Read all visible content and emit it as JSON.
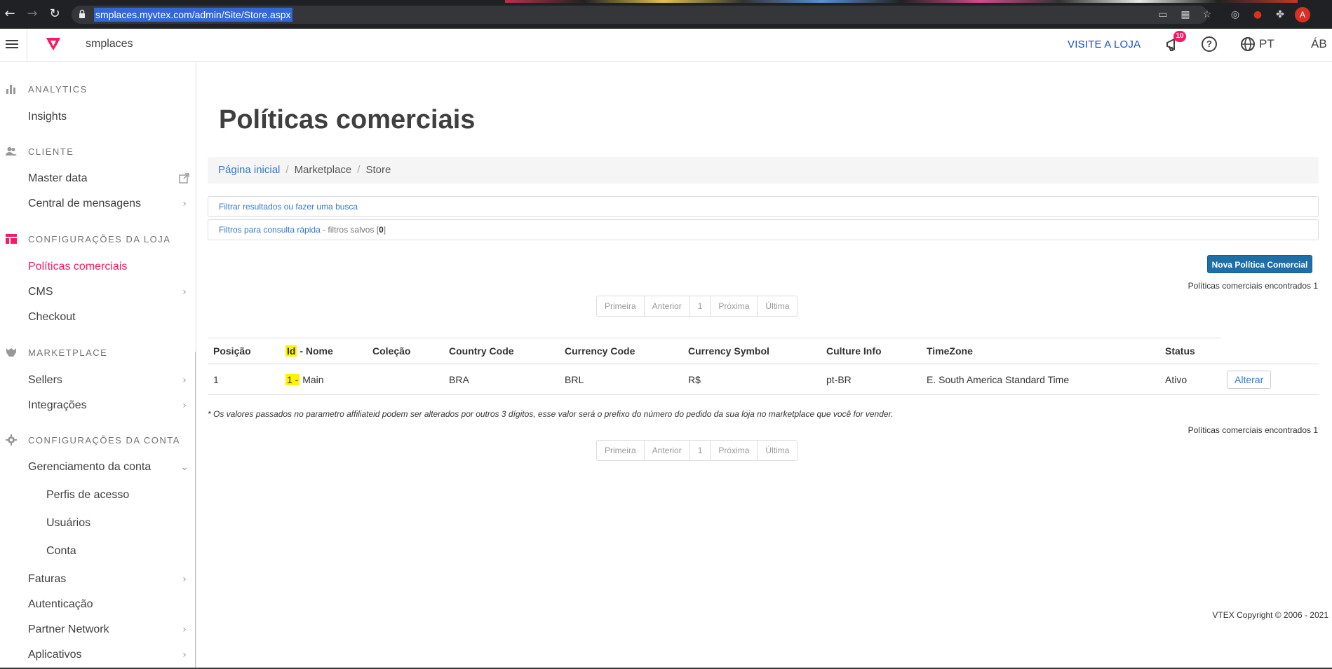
{
  "browser": {
    "url": "smplaces.myvtex.com/admin/Site/Store.aspx",
    "profile_initial": "A"
  },
  "topbar": {
    "store_name": "smplaces",
    "visit_store": "VISITE A LOJA",
    "notifications_count": "10",
    "language": "PT",
    "user_initials": "ÁB"
  },
  "sidebar": {
    "analytics": {
      "label": "ANALYTICS",
      "items": [
        "Insights"
      ]
    },
    "cliente": {
      "label": "CLIENTE",
      "items": [
        "Master data",
        "Central de mensagens"
      ]
    },
    "config_loja": {
      "label": "CONFIGURAÇÕES DA LOJA",
      "items": [
        "Políticas comerciais",
        "CMS",
        "Checkout"
      ]
    },
    "marketplace": {
      "label": "MARKETPLACE",
      "items": [
        "Sellers",
        "Integrações"
      ]
    },
    "config_conta": {
      "label": "CONFIGURAÇÕES DA CONTA",
      "items": [
        "Gerenciamento da conta",
        "Faturas",
        "Autenticação",
        "Partner Network",
        "Aplicativos"
      ],
      "subitems": [
        "Perfis de acesso",
        "Usuários",
        "Conta"
      ]
    }
  },
  "main": {
    "title": "Políticas comerciais",
    "breadcrumb": [
      "Página inicial",
      "Marketplace",
      "Store"
    ],
    "filter_search": "Filtrar resultados ou fazer uma busca",
    "quick_filters": "Filtros para consulta rápida",
    "saved_filters_prefix": " - filtros salvos [",
    "saved_filters_count": "0",
    "saved_filters_suffix": "]",
    "new_button": "Nova Política Comercial",
    "found_text": "Políticas comerciais encontrados 1",
    "pager": [
      "Primeira",
      "Anterior",
      "1",
      "Próxima",
      "Última"
    ],
    "table": {
      "headers": {
        "posicao": "Posição",
        "id": "Id",
        "nome": " - Nome",
        "colecao": "Coleção",
        "country": "Country Code",
        "currency": "Currency Code",
        "symbol": "Currency Symbol",
        "culture": "Culture Info",
        "timezone": "TimeZone",
        "status": "Status"
      },
      "rows": [
        {
          "posicao": "1",
          "id": "1 -",
          "nome": " Main",
          "colecao": "",
          "country": "BRA",
          "currency": "BRL",
          "symbol": "R$",
          "culture": "pt-BR",
          "timezone": "E. South America Standard Time",
          "status": "Ativo",
          "action": "Alterar"
        }
      ]
    },
    "note": "* Os valores passados no parametro affiliateid podem ser alterados por outros 3 dígitos, esse valor será o prefixo do número do pedido da sua loja no marketplace que você for vender.",
    "copyright": "VTEX Copyright © 2006 - 2021"
  },
  "colors": {
    "accent": "#f71963",
    "link": "#134cd8",
    "button": "#1e6fa8",
    "highlight": "#fff200"
  }
}
